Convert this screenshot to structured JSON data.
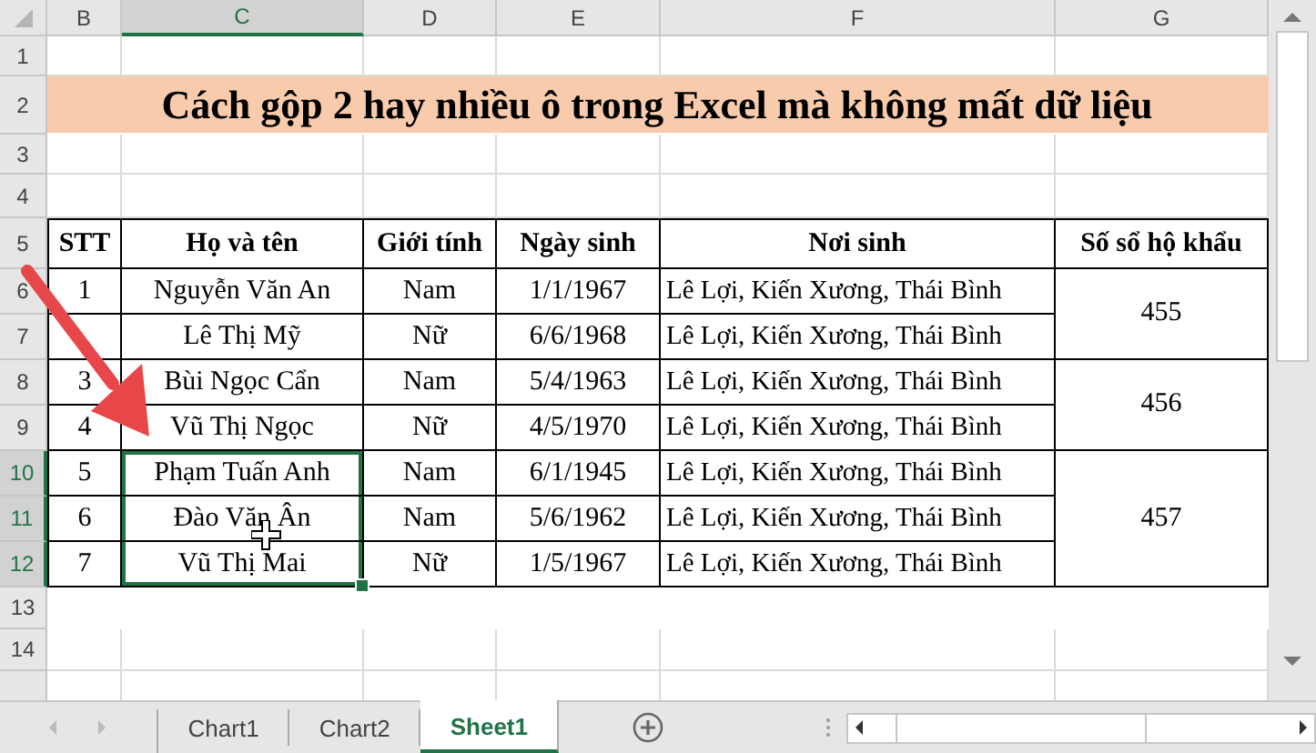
{
  "sheet": {
    "columns": [
      {
        "label": "B",
        "selected": false
      },
      {
        "label": "C",
        "selected": true
      },
      {
        "label": "D",
        "selected": false
      },
      {
        "label": "E",
        "selected": false
      },
      {
        "label": "F",
        "selected": false
      },
      {
        "label": "G",
        "selected": false
      }
    ],
    "rows": [
      {
        "label": "1",
        "selected": false
      },
      {
        "label": "2",
        "selected": false
      },
      {
        "label": "3",
        "selected": false
      },
      {
        "label": "4",
        "selected": false
      },
      {
        "label": "5",
        "selected": false
      },
      {
        "label": "6",
        "selected": false
      },
      {
        "label": "7",
        "selected": false
      },
      {
        "label": "8",
        "selected": false
      },
      {
        "label": "9",
        "selected": false
      },
      {
        "label": "10",
        "selected": true
      },
      {
        "label": "11",
        "selected": true
      },
      {
        "label": "12",
        "selected": true
      },
      {
        "label": "13",
        "selected": false
      },
      {
        "label": "14",
        "selected": false
      }
    ],
    "title": "Cách gộp 2 hay nhiều ô trong Excel mà không mất dữ liệu",
    "table": {
      "headers": [
        "STT",
        "Họ và tên",
        "Giới tính",
        "Ngày sinh",
        "Nơi sinh",
        "Số sổ hộ khẩu"
      ],
      "households": [
        {
          "number": "455",
          "records": [
            {
              "stt": "1",
              "name": "Nguyễn Văn An",
              "gender": "Nam",
              "birth_date": "1/1/1967",
              "birthplace": "Lê Lợi, Kiến Xương, Thái Bình",
              "selected": false
            },
            {
              "name": "Lê Thị Mỹ",
              "gender": "Nữ",
              "birth_date": "6/6/1968",
              "birthplace": "Lê Lợi, Kiến Xương, Thái Bình",
              "selected": false
            }
          ]
        },
        {
          "number": "456",
          "records": [
            {
              "stt": "3",
              "name": "Bùi Ngọc Cẩn",
              "gender": "Nam",
              "birth_date": "5/4/1963",
              "birthplace": "Lê Lợi, Kiến Xương, Thái Bình",
              "selected": false
            },
            {
              "stt": "4",
              "name": "Vũ Thị Ngọc",
              "gender": "Nữ",
              "birth_date": "4/5/1970",
              "birthplace": "Lê Lợi, Kiến Xương, Thái Bình",
              "selected": false
            }
          ]
        },
        {
          "number": "457",
          "records": [
            {
              "stt": "5",
              "name": "Phạm Tuấn Anh",
              "gender": "Nam",
              "birth_date": "6/1/1945",
              "birthplace": "Lê Lợi, Kiến Xương, Thái Bình",
              "selected": true
            },
            {
              "stt": "6",
              "name": "Đào Văn Ân",
              "gender": "Nam",
              "birth_date": "5/6/1962",
              "birthplace": "Lê Lợi, Kiến Xương, Thái Bình",
              "selected": true
            },
            {
              "stt": "7",
              "name": "Vũ Thị Mai",
              "gender": "Nữ",
              "birth_date": "1/5/1967",
              "birthplace": "Lê Lợi, Kiến Xương, Thái Bình",
              "selected": true
            }
          ]
        }
      ]
    }
  },
  "tabs": [
    {
      "label": "Chart1",
      "selected": false
    },
    {
      "label": "Chart2",
      "selected": false
    },
    {
      "label": "Sheet1",
      "selected": true
    }
  ]
}
